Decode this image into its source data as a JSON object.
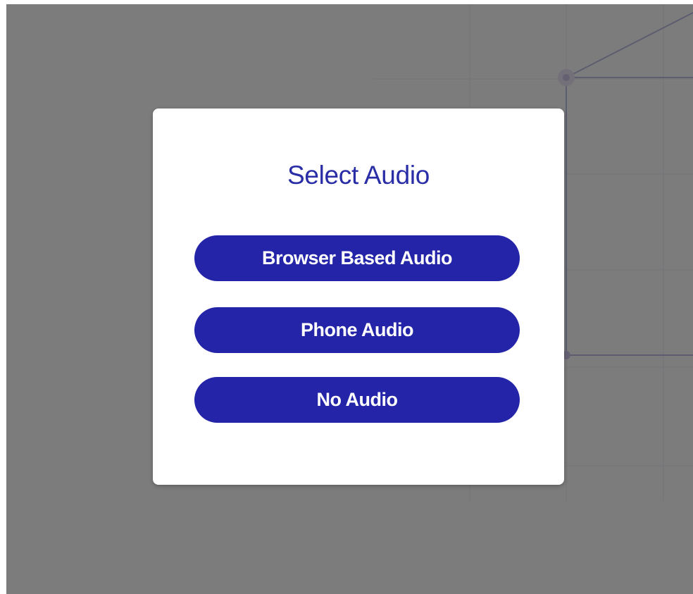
{
  "dialog": {
    "title": "Select Audio",
    "options": [
      {
        "label": "Browser Based Audio"
      },
      {
        "label": "Phone Audio"
      },
      {
        "label": "No Audio"
      }
    ]
  },
  "colors": {
    "accent": "#2424a8",
    "title": "#2a2ea6",
    "overlay": "rgba(100,100,100,0.82)",
    "modal_background": "#ffffff"
  }
}
